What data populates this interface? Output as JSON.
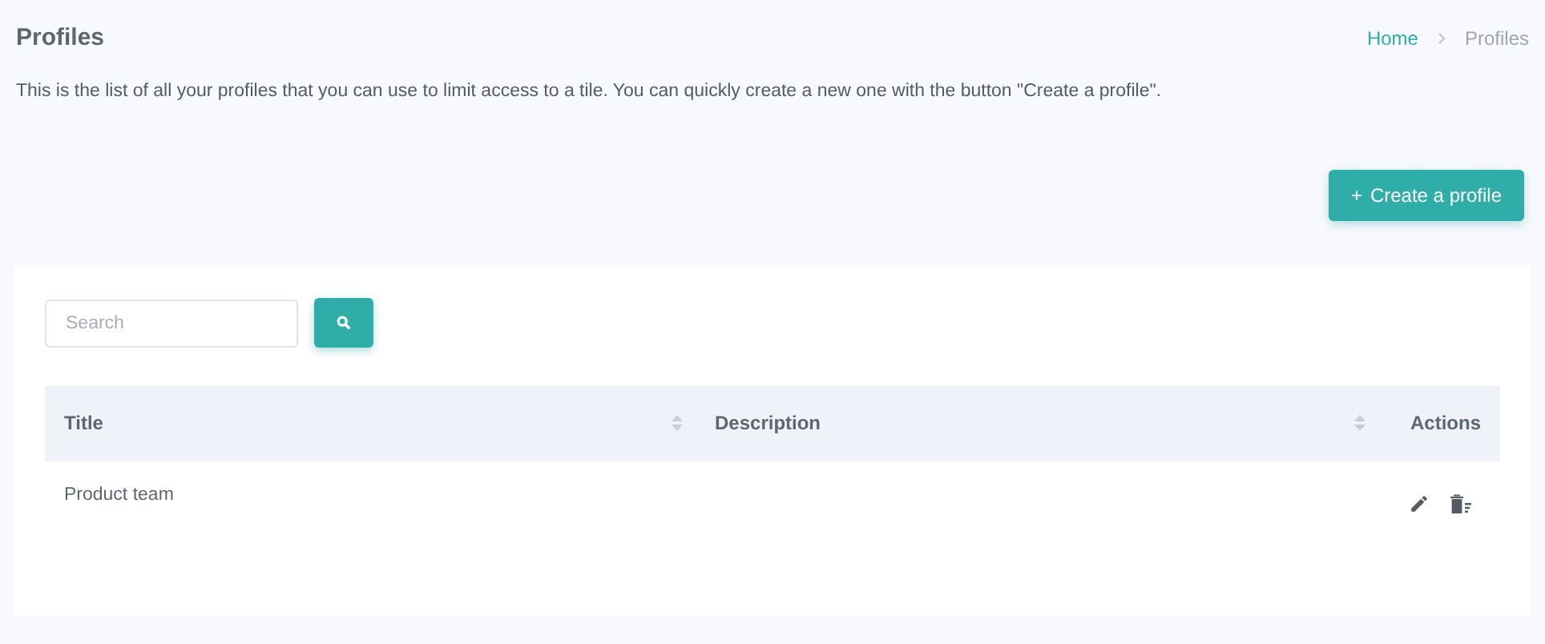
{
  "page": {
    "title": "Profiles",
    "description": "This is the list of all your profiles that you can use to limit access to a tile. You can quickly create a new one with the button \"Create a profile\"."
  },
  "breadcrumb": [
    {
      "label": "Home",
      "kind": "link"
    },
    {
      "label": "Profiles",
      "kind": "current"
    }
  ],
  "create_button": {
    "icon": "+",
    "label": "Create a profile"
  },
  "search": {
    "placeholder": "Search"
  },
  "table": {
    "columns": [
      {
        "label": "Title",
        "sortable": true
      },
      {
        "label": "Description",
        "sortable": true
      },
      {
        "label": "Actions",
        "sortable": false
      }
    ],
    "rows": [
      {
        "title": "Product team"
      }
    ]
  }
}
